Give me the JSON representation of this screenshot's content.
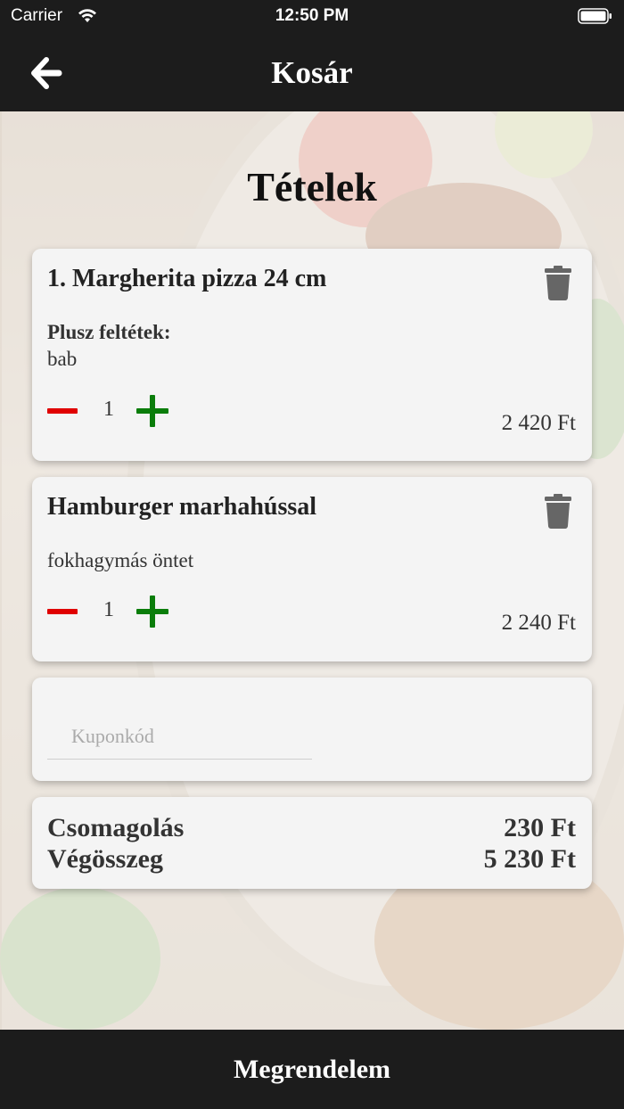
{
  "status_bar": {
    "carrier": "Carrier",
    "time": "12:50 PM"
  },
  "nav": {
    "title": "Kosár",
    "back_icon": "arrow-left-icon"
  },
  "section_title": "Tételek",
  "items": [
    {
      "name": "1. Margherita pizza 24 cm",
      "extras_label": "Plusz feltétek:",
      "extras": "bab",
      "quantity": "1",
      "price": "2 420 Ft"
    },
    {
      "name": "Hamburger marhahússal",
      "extras": "fokhagymás öntet",
      "quantity": "1",
      "price": "2 240 Ft"
    }
  ],
  "coupon": {
    "placeholder": "Kuponkód",
    "value": ""
  },
  "totals": {
    "packaging_label": "Csomagolás",
    "packaging_value": "230 Ft",
    "total_label": "Végösszeg",
    "total_value": "5 230 Ft"
  },
  "order_button": "Megrendelem",
  "colors": {
    "bar": "#1c1c1c",
    "minus": "#e00000",
    "plus": "#0a7d0a",
    "card": "#f4f4f4"
  }
}
